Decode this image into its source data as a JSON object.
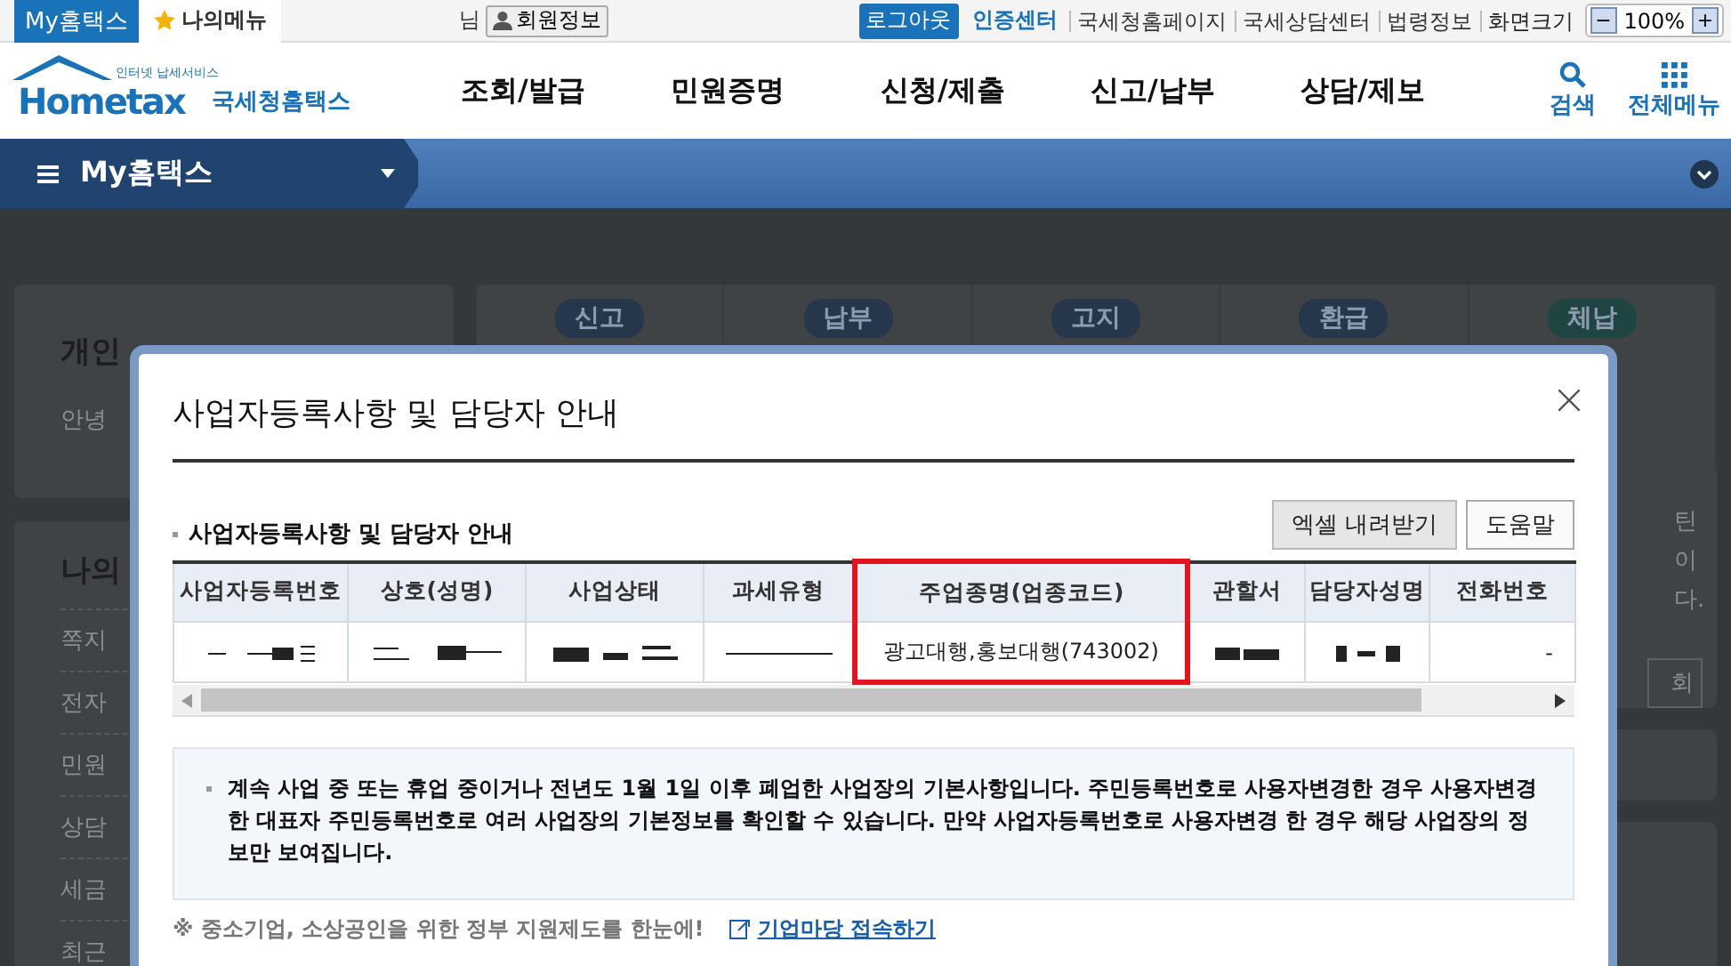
{
  "top_bar": {
    "my_tab": "My홈택스",
    "my_menu": "나의메뉴",
    "user_suffix": "님",
    "member_info": "회원정보",
    "logout": "로그아웃",
    "cert_center": "인증센터",
    "links": [
      "국세청홈페이지",
      "국세상담센터",
      "법령정보"
    ],
    "zoom_label": "화면크기",
    "zoom_minus": "−",
    "zoom_value": "100%",
    "zoom_plus": "+"
  },
  "header": {
    "logo_text": "Hometax",
    "logo_tagline": "인터넷 납세서비스",
    "logo_name": "국세청홈택스",
    "nav": [
      "조회/발급",
      "민원증명",
      "신청/제출",
      "신고/납부",
      "상담/제보"
    ],
    "search": "검색",
    "all_menu": "전체메뉴"
  },
  "sub_nav": {
    "title": "My홈택스"
  },
  "background": {
    "left_card_title": "개인",
    "left_card_text": "안녕",
    "my_title": "나의",
    "my_items": [
      "쪽지",
      "전자",
      "민원",
      "상담",
      "세금",
      "최근"
    ],
    "badges": [
      {
        "label": "신고",
        "color": "#26364b"
      },
      {
        "label": "납부",
        "color": "#26364b"
      },
      {
        "label": "고지",
        "color": "#26364b"
      },
      {
        "label": "환급",
        "color": "#26364b"
      },
      {
        "label": "체납",
        "color": "#1e4541"
      }
    ],
    "right_fragments": [
      "틴",
      "이",
      "다."
    ],
    "right_button": "회"
  },
  "dialog": {
    "title": "사업자등록사항 및 담당자 안내",
    "section_title": "사업자등록사항 및 담당자 안내",
    "buttons": [
      "엑셀 내려받기",
      "도움말"
    ],
    "columns": [
      {
        "label": "사업자등록번호",
        "highlighted": false
      },
      {
        "label": "상호(성명)",
        "highlighted": false
      },
      {
        "label": "사업상태",
        "highlighted": false
      },
      {
        "label": "과세유형",
        "highlighted": false
      },
      {
        "label": "주업종명(업종코드)",
        "highlighted": true
      },
      {
        "label": "관할서",
        "highlighted": false
      },
      {
        "label": "담당자성명",
        "highlighted": false
      },
      {
        "label": "전화번호",
        "highlighted": false
      }
    ],
    "row": [
      {
        "kind": "redacted"
      },
      {
        "kind": "redacted"
      },
      {
        "kind": "redacted"
      },
      {
        "kind": "redacted"
      },
      {
        "kind": "text",
        "text": "광고대행,홍보대행(743002)"
      },
      {
        "kind": "redacted"
      },
      {
        "kind": "redacted"
      },
      {
        "kind": "text",
        "text": "-"
      }
    ],
    "notice": "계속 사업 중 또는 휴업 중이거나 전년도 1월 1일 이후 폐업한 사업장의 기본사항입니다. 주민등록번호로 사용자변경한 경우 사용자변경한 대표자 주민등록번호로 여러 사업장의 기본정보를 확인할 수 있습니다. 만약 사업자등록번호로 사용자변경 한 경우 해당 사업장의 정보만 보여집니다.",
    "footer_note": "※ 중소기업, 소상공인을 위한 정부 지원제도를 한눈에!",
    "footer_link": "기업마당 접속하기"
  }
}
